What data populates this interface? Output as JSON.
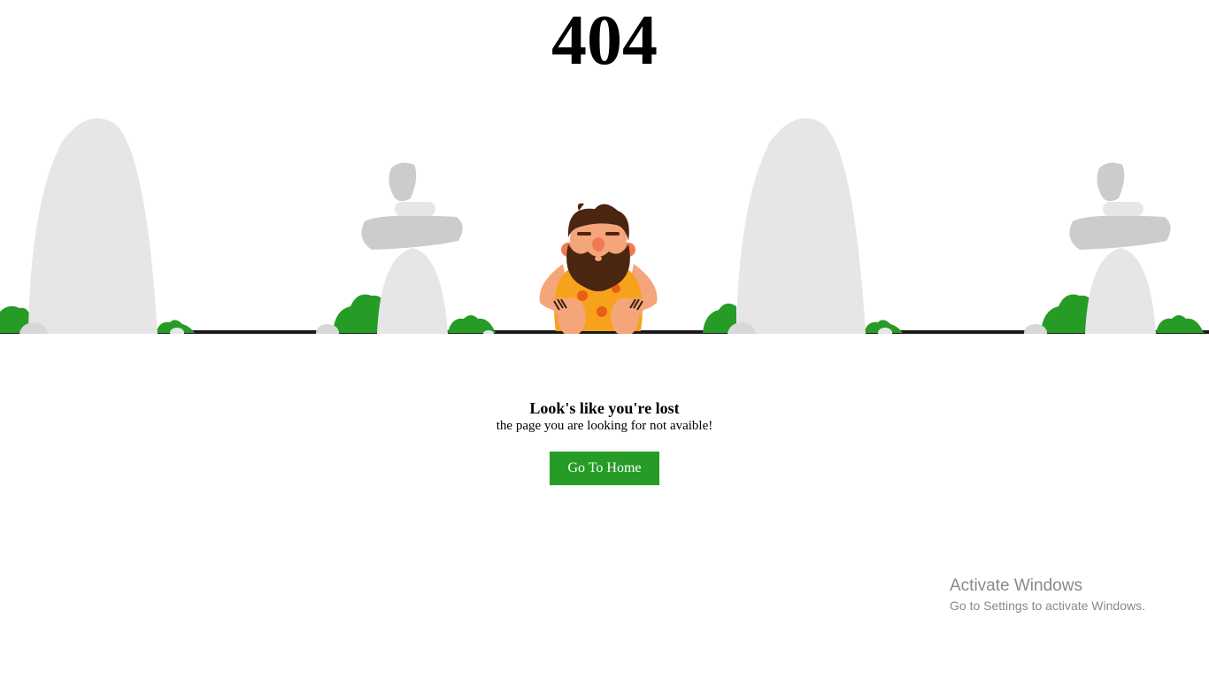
{
  "error": {
    "code": "404"
  },
  "message": {
    "title": "Look's like you're lost",
    "subtitle": "the page you are looking for not avaible!"
  },
  "actions": {
    "home_label": "Go To Home"
  },
  "watermark": {
    "title": "Activate Windows",
    "subtitle": "Go to Settings to activate Windows."
  },
  "colors": {
    "button": "#269c26",
    "bush": "#269c26",
    "rock_light": "#e6e6e6",
    "rock_mid": "#cccccc",
    "skin": "#f5a57a",
    "hair": "#4a2511",
    "tunic": "#f7a21b"
  },
  "illustration": {
    "name": "caveman-sitting-on-rope"
  }
}
